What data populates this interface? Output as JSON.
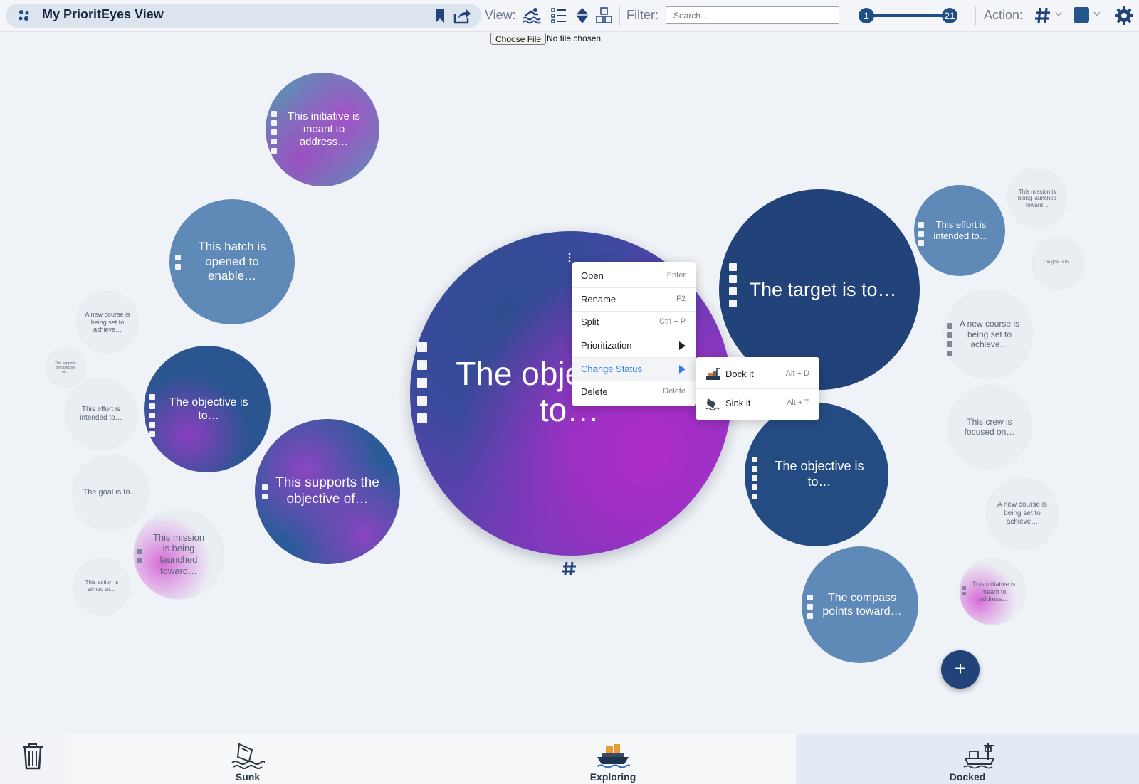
{
  "app": {
    "title": "My PrioritEyes View"
  },
  "toolbar": {
    "view_label": "View:",
    "filter_label": "Filter:",
    "search_placeholder": "Search...",
    "range_min": "1",
    "range_max": "21",
    "action_label": "Action:",
    "view_icons": [
      "swimmers-icon",
      "checklist-icon",
      "iceberg-icon",
      "blocks-icon"
    ],
    "action_icons": [
      "hashtag-icon",
      "color-square-icon",
      "settings-gear-icon"
    ],
    "accent_color": "#1f4f86"
  },
  "file_input": {
    "button_label": "Choose File",
    "status": "No file chosen"
  },
  "main_bubble": {
    "text": "The objective is to…"
  },
  "bubbles": [
    {
      "text": "This initiative is meant to address…"
    },
    {
      "text": "This hatch is opened to enable…"
    },
    {
      "text": "A new course is being set to achieve…"
    },
    {
      "text": "This supports the objective of…"
    },
    {
      "text": "The objective is to…"
    },
    {
      "text": "This effort is intended to…"
    },
    {
      "text": "The goal is to…"
    },
    {
      "text": "This mission is being launched toward…"
    },
    {
      "text": "This action is aimed at…"
    },
    {
      "text": "This supports the objective of…"
    },
    {
      "text": "The target is to…"
    },
    {
      "text": "This effort is intended to…"
    },
    {
      "text": "This mission is being launched toward…"
    },
    {
      "text": "The goal is to…"
    },
    {
      "text": "A new course is being set to achieve…"
    },
    {
      "text": "This crew is focused on…"
    },
    {
      "text": "The objective is to…"
    },
    {
      "text": "A new course is being set to achieve…"
    },
    {
      "text": "The compass points toward…"
    },
    {
      "text": "This initiative is meant to address…"
    }
  ],
  "context_menu": {
    "items": [
      {
        "label": "Open",
        "shortcut": "Enter"
      },
      {
        "label": "Rename",
        "shortcut": "F2"
      },
      {
        "label": "Split",
        "shortcut": "Ctrl + P"
      },
      {
        "label": "Prioritization",
        "shortcut": ""
      },
      {
        "label": "Change Status",
        "shortcut": ""
      },
      {
        "label": "Delete",
        "shortcut": "Delete"
      }
    ],
    "active_item": "Change Status"
  },
  "status_submenu": {
    "items": [
      {
        "label": "Dock it",
        "shortcut": "Alt + D",
        "icon": "dock-icon"
      },
      {
        "label": "Sink it",
        "shortcut": "Alt + T",
        "icon": "sink-icon"
      }
    ]
  },
  "fab": {
    "label": "+"
  },
  "bottom_zones": [
    {
      "label": "Sunk",
      "icon": "sinking-ship-icon"
    },
    {
      "label": "Exploring",
      "icon": "exploring-ship-icon"
    },
    {
      "label": "Docked",
      "icon": "docked-ship-icon"
    }
  ]
}
